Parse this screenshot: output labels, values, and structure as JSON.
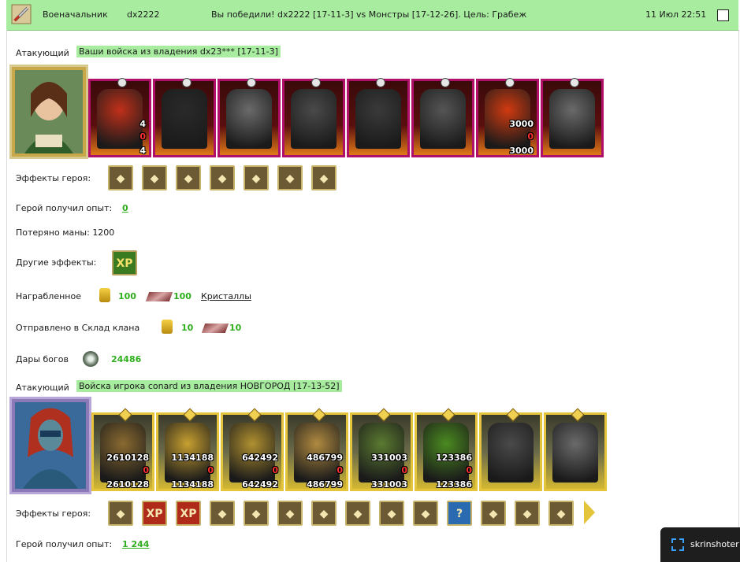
{
  "topbar": {
    "role": "Военачальник",
    "player": "dx2222",
    "battle_text": "Вы победили! dx2222 [17-11-3] vs Монстры [17-12-26]. Цель: Грабеж",
    "datetime": "11 Июл 22:51"
  },
  "side1": {
    "label": "Атакующий",
    "army_title": "Ваши войска из владения dx23*** [17-11-3]",
    "units": [
      {
        "n1": "4",
        "n2": "0",
        "n3": "4",
        "color": "#c0301a"
      },
      {
        "n1": "",
        "n2": "",
        "n3": "",
        "color": "#2a2a2a"
      },
      {
        "n1": "",
        "n2": "",
        "n3": "",
        "color": "#6a6a6a"
      },
      {
        "n1": "",
        "n2": "",
        "n3": "",
        "color": "#4a4a4a"
      },
      {
        "n1": "",
        "n2": "",
        "n3": "",
        "color": "#3a3a3a"
      },
      {
        "n1": "",
        "n2": "",
        "n3": "",
        "color": "#555555"
      },
      {
        "n1": "3000",
        "n2": "0",
        "n3": "3000",
        "color": "#d03a10"
      },
      {
        "n1": "",
        "n2": "",
        "n3": "",
        "color": "#6a6a6a"
      }
    ],
    "hero_effects_label": "Эффекты героя:",
    "hero_effects": [
      "leaf-icon",
      "armor-icon",
      "ring-icon",
      "crossbow-icon",
      "cloak-icon",
      "bench-icon",
      "horse-icon"
    ],
    "xp_label": "Герой получил опыт:",
    "xp_value": "0",
    "mana_text": "Потеряно маны: 1200",
    "other_effects_label": "Другие эффекты:",
    "other_effect_icon": "XP",
    "loot_label": "Награбленное",
    "loot_gold": "100",
    "loot_crystal": "100",
    "loot_link": "Кристаллы",
    "clan_label": "Отправлено в Склад клана",
    "clan_gold": "10",
    "clan_crystal": "10",
    "gifts_label": "Дары богов",
    "gifts_value": "24486"
  },
  "side2": {
    "label": "Атакующий",
    "army_title": "Войска игрока conard из владения НОВГОРОД [17-13-52]",
    "units": [
      {
        "n1": "2610128",
        "n2": "0",
        "n3": "2610128",
        "color": "#8a6a30"
      },
      {
        "n1": "1134188",
        "n2": "0",
        "n3": "1134188",
        "color": "#c8a030"
      },
      {
        "n1": "642492",
        "n2": "0",
        "n3": "642492",
        "color": "#b09030"
      },
      {
        "n1": "486799",
        "n2": "0",
        "n3": "486799",
        "color": "#b08a40"
      },
      {
        "n1": "331003",
        "n2": "0",
        "n3": "331003",
        "color": "#5a7a30"
      },
      {
        "n1": "123386",
        "n2": "0",
        "n3": "123386",
        "color": "#4a8a20"
      },
      {
        "n1": "",
        "n2": "",
        "n3": "",
        "color": "#4a4a4a"
      },
      {
        "n1": "",
        "n2": "",
        "n3": "",
        "color": "#6a6a6a"
      }
    ],
    "hero_effects_label": "Эффекты героя:",
    "hero_effects": [
      "pouch-icon",
      "XP",
      "XP",
      "drum-icon",
      "dice-icon",
      "shield-icon",
      "hand-shield-icon",
      "barrel-icon",
      "cross-icon",
      "chest-icon",
      "?",
      "spider-icon",
      "clover-icon",
      "staff-icon"
    ],
    "xp_label": "Герой получил опыт:",
    "xp_value": "1 244"
  },
  "skrinshoter": {
    "label": "skrinshoter"
  }
}
